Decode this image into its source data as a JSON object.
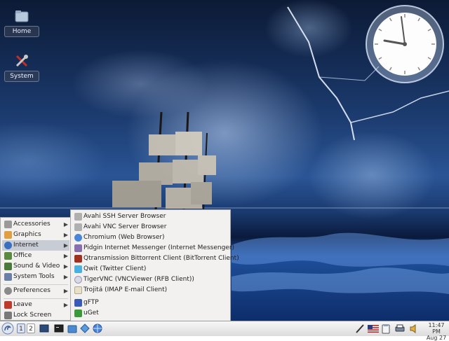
{
  "desktop": {
    "icons": [
      {
        "label": "Home",
        "icon": "home-folder-icon"
      },
      {
        "label": "System",
        "icon": "system-tools-icon"
      }
    ]
  },
  "menu": {
    "items": [
      {
        "label": "Accessories",
        "icon": "accessories-icon",
        "submenu": true
      },
      {
        "label": "Graphics",
        "icon": "graphics-icon",
        "submenu": true
      },
      {
        "label": "Internet",
        "icon": "internet-globe-icon",
        "submenu": true,
        "active": true
      },
      {
        "label": "Office",
        "icon": "office-icon",
        "submenu": true
      },
      {
        "label": "Sound & Video",
        "icon": "sound-video-icon",
        "submenu": true
      },
      {
        "label": "System Tools",
        "icon": "system-tools-icon",
        "submenu": true
      },
      {
        "label": "Preferences",
        "icon": "preferences-icon",
        "submenu": true
      },
      {
        "label": "Leave",
        "icon": "leave-icon",
        "submenu": true
      },
      {
        "label": "Lock Screen",
        "icon": "lock-screen-icon",
        "submenu": false
      }
    ],
    "internet_submenu": [
      {
        "label": "Avahi SSH Server Browser",
        "icon": "network-tool-icon"
      },
      {
        "label": "Avahi VNC Server Browser",
        "icon": "network-tool-icon"
      },
      {
        "label": "Chromium (Web Browser)",
        "icon": "chromium-icon"
      },
      {
        "label": "Pidgin Internet Messenger (Internet Messenger)",
        "icon": "pidgin-icon"
      },
      {
        "label": "Qtransmission Bittorrent Client (BitTorrent Client)",
        "icon": "transmission-icon"
      },
      {
        "label": "Qwit (Twitter Client)",
        "icon": "qwit-icon"
      },
      {
        "label": "TigerVNC (VNCViewer (RFB Client))",
        "icon": "vnc-icon"
      },
      {
        "label": "Trojitá (IMAP E-mail Client)",
        "icon": "mail-client-icon"
      },
      {
        "label": "gFTP",
        "icon": "ftp-download-icon"
      },
      {
        "label": "uGet",
        "icon": "uget-icon"
      }
    ]
  },
  "taskbar": {
    "workspaces": [
      "1",
      "2"
    ],
    "time": "11:47 PM",
    "date": "Aug 27",
    "tray_icons": [
      "network-tool-icon",
      "us-flag-icon",
      "clipboard-icon",
      "printer-icon",
      "volume-icon"
    ],
    "launchers": [
      "show-desktop-icon",
      "terminal-icon",
      "file-manager-icon",
      "settings-icon",
      "web-browser-icon"
    ]
  }
}
